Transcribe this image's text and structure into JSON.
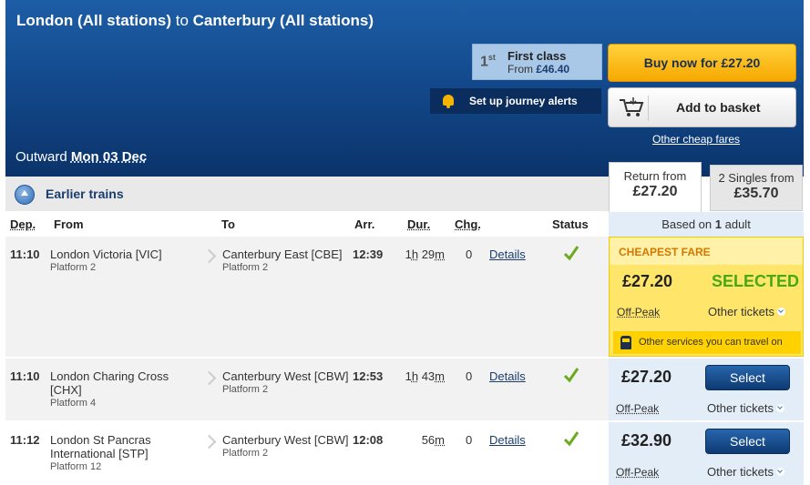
{
  "header": {
    "origin": "London (All stations)",
    "to_word": "to",
    "destination": "Canterbury (All stations)",
    "first_class": {
      "ordinal": "1",
      "ordinal_suffix": "st",
      "title": "First class",
      "from_label": "From",
      "from_price": "£46.40"
    },
    "buy_now": "Buy now for £27.20",
    "journey_alerts": "Set up journey alerts",
    "add_to_basket": "Add to basket",
    "other_cheap_fares": "Other cheap fares",
    "outward_label": "Outward",
    "outward_date": "Mon 03 Dec"
  },
  "earlier_trains": "Earlier trains",
  "columns": {
    "dep": "Dep.",
    "from": "From",
    "to": "To",
    "arr": "Arr.",
    "dur": "Dur.",
    "chg": "Chg.",
    "status": "Status"
  },
  "fare_tabs": {
    "return_label": "Return from",
    "return_price": "£27.20",
    "singles_label": "2 Singles from",
    "singles_price": "£35.70",
    "based_on_prefix": "Based on",
    "based_on_count": "1",
    "based_on_suffix": "adult"
  },
  "journeys": [
    {
      "dep": "11:10",
      "from": "London Victoria [VIC]",
      "from_platform": "Platform 2",
      "to": "Canterbury East [CBE]",
      "to_platform": "Platform 2",
      "arr": "12:39",
      "dur_h": "1",
      "dur_m": "29",
      "chg": "0",
      "details": "Details"
    },
    {
      "dep": "11:10",
      "from": "London Charing Cross [CHX]",
      "from_platform": "Platform 4",
      "to": "Canterbury West [CBW]",
      "to_platform": "Platform 2",
      "arr": "12:53",
      "dur_h": "1",
      "dur_m": "43",
      "chg": "0",
      "details": "Details"
    },
    {
      "dep": "11:12",
      "from": "London St Pancras International [STP]",
      "from_platform": "Platform 12",
      "to": "Canterbury West [CBW]",
      "to_platform": "Platform 2",
      "arr": "12:08",
      "dur_h": "",
      "dur_m": "56",
      "chg": "0",
      "details": "Details"
    }
  ],
  "units": {
    "hour": "h",
    "minute": "m"
  },
  "fares": [
    {
      "banner": "CHEAPEST FARE",
      "price": "£27.20",
      "state": "SELECTED",
      "type": "Off-Peak",
      "other": "Other tickets",
      "info": "Other services you can travel on"
    },
    {
      "price": "£27.20",
      "button": "Select",
      "type": "Off-Peak",
      "other": "Other tickets"
    },
    {
      "price": "£32.90",
      "button": "Select",
      "type": "Off-Peak",
      "other": "Other tickets"
    }
  ],
  "colors": {
    "header_blue": "#134a8d",
    "buy_orange": "#f7a800",
    "selected_green": "#46a815",
    "select_blue": "#0e3a72",
    "cheapest_yellow": "#ffe66a"
  }
}
